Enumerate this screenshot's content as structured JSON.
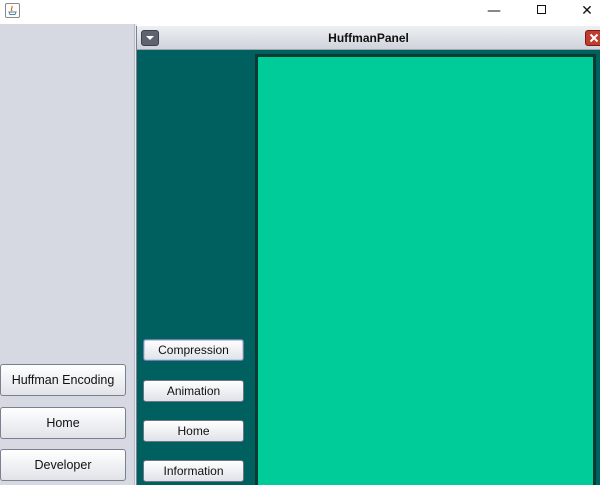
{
  "window": {
    "controls": {
      "minimize": "—",
      "close": "✕"
    }
  },
  "left_nav": {
    "buttons": [
      {
        "label": "Huffman Encoding"
      },
      {
        "label": "Home"
      },
      {
        "label": "Developer"
      }
    ]
  },
  "internal_frame": {
    "title": "HuffmanPanel",
    "side_buttons": [
      {
        "label": "Compression"
      },
      {
        "label": "Animation"
      },
      {
        "label": "Home"
      },
      {
        "label": "Information"
      }
    ]
  },
  "colors": {
    "side_strip": "#005f5f",
    "canvas": "#00cc99",
    "left_panel": "#d6d9e1"
  },
  "icons": {
    "app": "java-icon",
    "frame_menu": "chevron-down-icon",
    "frame_close": "close-icon"
  }
}
